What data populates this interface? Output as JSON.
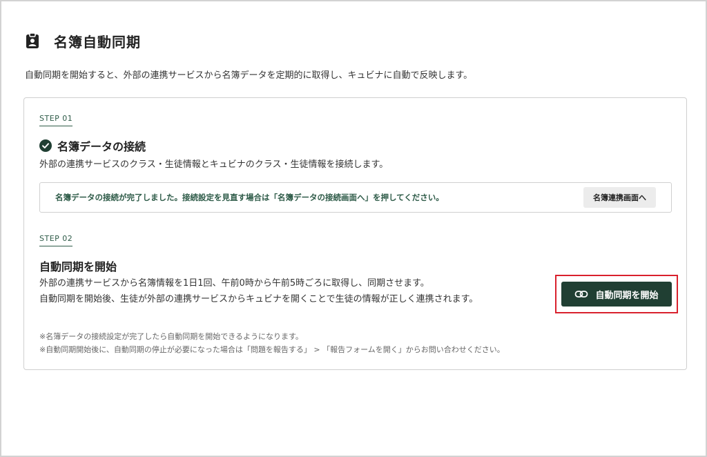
{
  "header": {
    "title": "名簿自動同期",
    "description": "自動同期を開始すると、外部の連携サービスから名簿データを定期的に取得し、キュビナに自動で反映します。"
  },
  "step1": {
    "label": "STEP 01",
    "title": "名簿データの接続",
    "description": "外部の連携サービスのクラス・生徒情報とキュビナのクラス・生徒情報を接続します。",
    "notice": "名簿データの接続が完了しました。接続設定を見直す場合は「名簿データの接続画面へ」を押してください。",
    "notice_button": "名簿連携画面へ"
  },
  "step2": {
    "label": "STEP 02",
    "title": "自動同期を開始",
    "description_line1": "外部の連携サービスから名簿情報を1日1回、午前0時から午前5時ごろに取得し、同期させます。",
    "description_line2": "自動同期を開始後、生徒が外部の連携サービスからキュビナを開くことで生徒の情報が正しく連携されます。",
    "start_button": "自動同期を開始"
  },
  "notes": [
    "※名簿データの接続設定が完了したら自動同期を開始できるようになります。",
    "※自動同期開始後に、自動同期の停止が必要になった場合は「問題を報告する」 > 「報告フォームを開く」からお問い合わせください。"
  ],
  "icons": {
    "header": "clipboard-user-icon",
    "step1_status": "check-circle-icon",
    "start_button": "link-icon"
  },
  "colors": {
    "accent": "#203f33",
    "accent_text": "#2e5b48",
    "highlight": "#d9202c"
  }
}
